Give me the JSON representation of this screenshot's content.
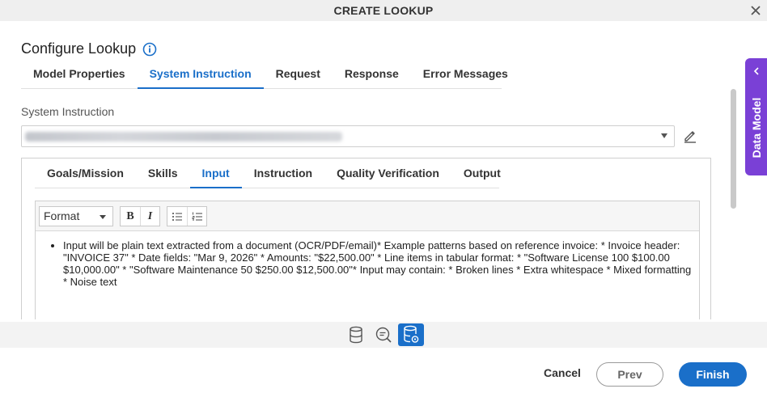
{
  "dialog": {
    "title": "CREATE LOOKUP",
    "close_icon": "close-icon"
  },
  "heading": {
    "text": "Configure Lookup",
    "info_icon": "info-icon"
  },
  "main_tabs": [
    {
      "label": "Model Properties",
      "active": false
    },
    {
      "label": "System Instruction",
      "active": true
    },
    {
      "label": "Request",
      "active": false
    },
    {
      "label": "Response",
      "active": false
    },
    {
      "label": "Error Messages",
      "active": false
    }
  ],
  "system_instruction": {
    "label": "System Instruction",
    "selected_value": "Extract Invoice Data and_DgtPVFHF0bn1rPsmjkH1rZpendi",
    "value_blurred": true,
    "edit_icon": "pencil-icon"
  },
  "inner_tabs": [
    {
      "label": "Goals/Mission",
      "active": false
    },
    {
      "label": "Skills",
      "active": false
    },
    {
      "label": "Input",
      "active": true
    },
    {
      "label": "Instruction",
      "active": false
    },
    {
      "label": "Quality Verification",
      "active": false
    },
    {
      "label": "Output",
      "active": false
    }
  ],
  "editor": {
    "format_label": "Format",
    "bold_label": "B",
    "italic_label": "I",
    "icons": [
      "bullet-list-icon",
      "numbered-list-icon"
    ],
    "content": "Input will be plain text extracted from a document (OCR/PDF/email)* Example patterns based on reference invoice: * Invoice header: \"INVOICE 37\" * Date fields: \"Mar 9, 2026\" * Amounts: \"$22,500.00\" * Line items in tabular format: * \"Software License 100 $100.00 $10,000.00\" * \"Software Maintenance 50 $250.00 $12,500.00\"* Input may contain: * Broken lines * Extra whitespace * Mixed formatting * Noise text"
  },
  "side_panel": {
    "label": "Data Model",
    "icon": "chevron-left-icon"
  },
  "bottom_icons": [
    "database-icon",
    "search-comment-icon",
    "database-settings-icon"
  ],
  "footer": {
    "cancel": "Cancel",
    "prev": "Prev",
    "finish": "Finish"
  },
  "colors": {
    "accent": "#1a6fc9",
    "side_panel": "#7a40d6"
  }
}
